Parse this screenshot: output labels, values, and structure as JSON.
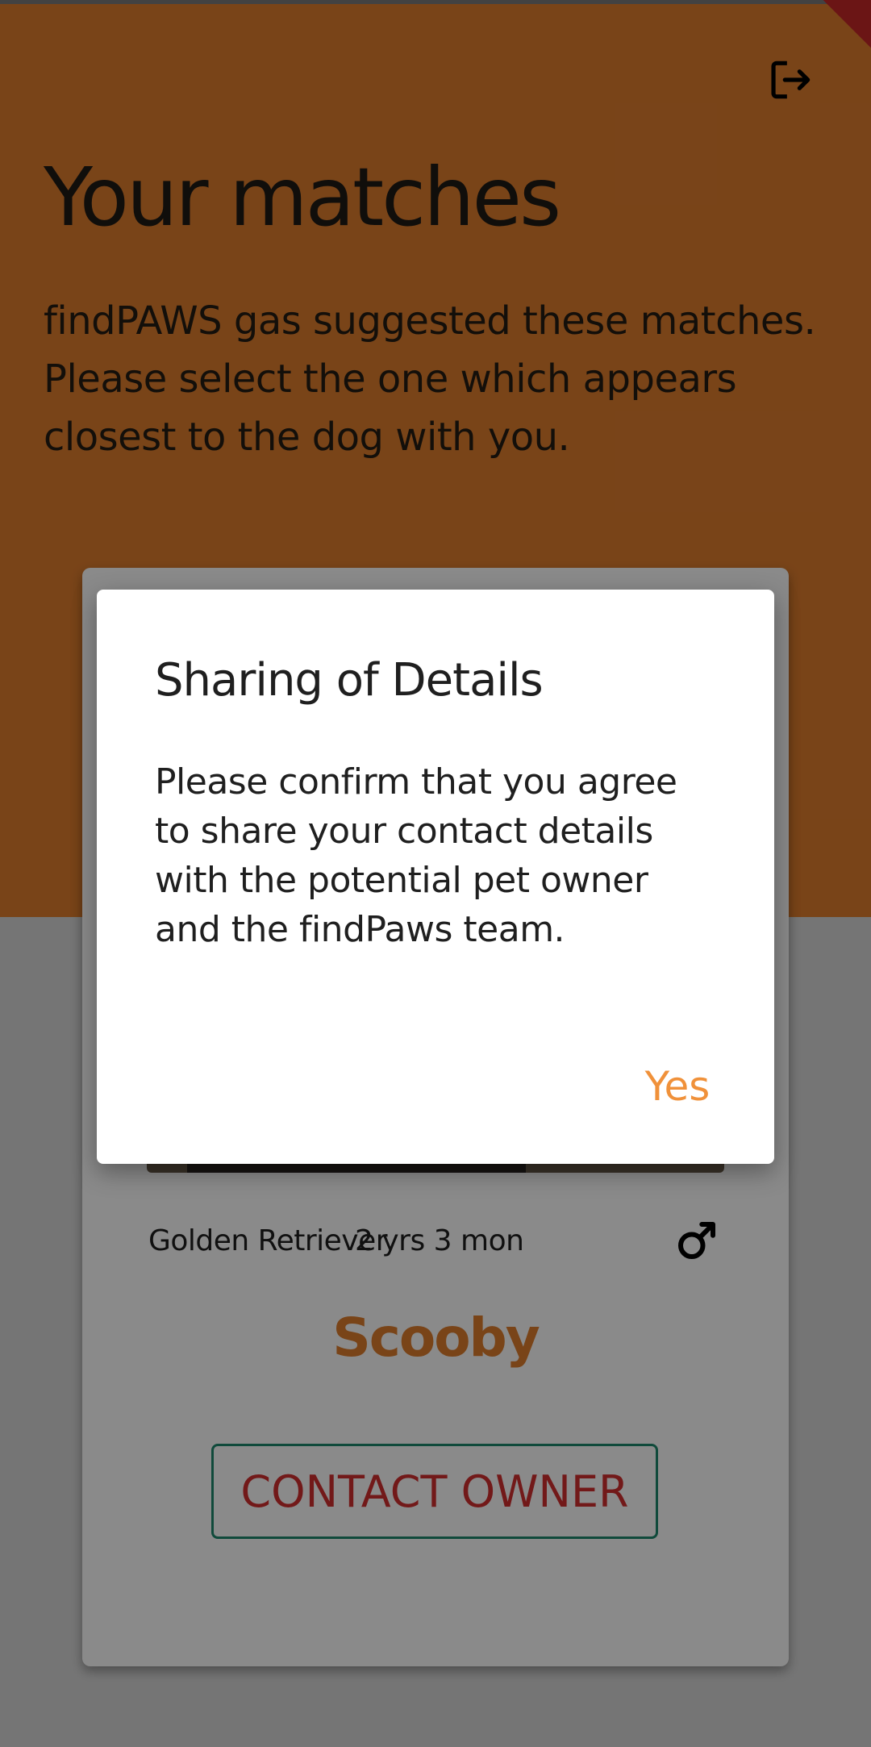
{
  "header": {
    "title": "Your matches",
    "subtitle": "findPAWS gas suggested these matches. Please select the one which appears closest to the dog with you.",
    "logout_icon": "logout-icon"
  },
  "card": {
    "breed": "Golden Retriever",
    "age": "2 yrs  3 mon",
    "gender_icon": "male-icon",
    "name": "Scooby",
    "contact_label": "CONTACT OWNER"
  },
  "dialog": {
    "title": "Sharing of Details",
    "body": "Please confirm that you agree to share your contact details with the potential pet owner and the findPaws team.",
    "confirm_label": "Yes"
  },
  "colors": {
    "accent": "#e07e2e",
    "contact_text": "#d32f2f",
    "contact_border": "#1f8a6e",
    "dialog_action": "#f0913a"
  }
}
